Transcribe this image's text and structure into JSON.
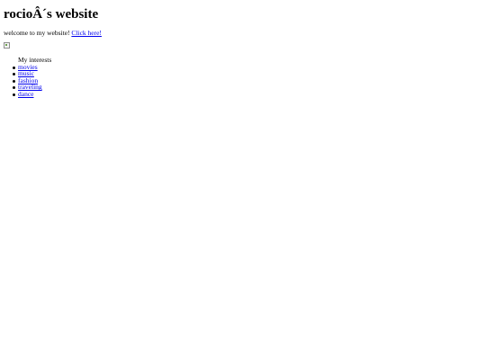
{
  "page": {
    "title": "rocioÂ´s website",
    "intro_text": "welcome to my website!",
    "intro_link": "Click here!"
  },
  "interests": {
    "heading": "My interests",
    "items": [
      {
        "label": "movies"
      },
      {
        "label": "music"
      },
      {
        "label": "fashion"
      },
      {
        "label": "traveling"
      },
      {
        "label": "dance"
      }
    ]
  },
  "icons": {
    "broken_image": "broken-image-icon"
  }
}
